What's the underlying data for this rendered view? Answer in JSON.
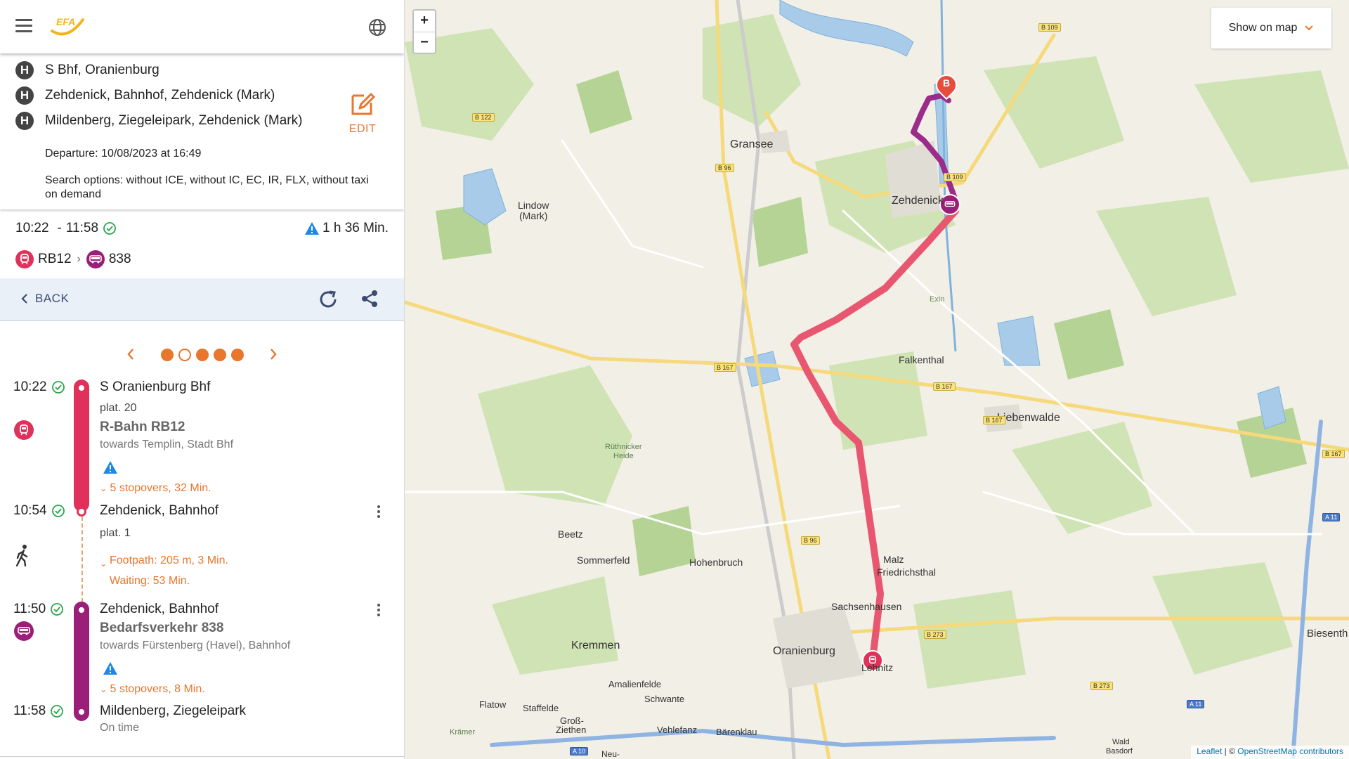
{
  "app": {
    "logo_text": "EFA"
  },
  "stops": [
    {
      "badge": "H",
      "name": "S Bhf, Oranienburg"
    },
    {
      "badge": "H",
      "name": "Zehdenick, Bahnhof, Zehdenick (Mark)"
    },
    {
      "badge": "H",
      "name": "Mildenberg, Ziegeleipark, Zehdenick (Mark)"
    }
  ],
  "edit_label": "EDIT",
  "departure": "Departure: 10/08/2023 at 16:49",
  "search_options": "Search options: without ICE, without IC, EC, IR, FLX, without taxi on demand",
  "summary": {
    "start": "10:22",
    "separator": "-",
    "end": "11:58",
    "duration": "1 h 36 Min.",
    "line1": "RB12",
    "line2": "838"
  },
  "back_label": "BACK",
  "legs": {
    "leg1": {
      "time": "10:22",
      "station": "S Oranienburg Bhf",
      "platform": "plat. 20",
      "line": "R-Bahn RB12",
      "towards": "towards Templin, Stadt Bhf",
      "stopovers": "5 stopovers, 32 Min."
    },
    "transfer": {
      "time": "10:54",
      "station": "Zehdenick, Bahnhof",
      "platform": "plat. 1",
      "footpath": "Footpath: 205 m, 3 Min.",
      "waiting": "Waiting: 53 Min."
    },
    "leg2": {
      "time": "11:50",
      "station": "Zehdenick, Bahnhof",
      "line": "Bedarfsverkehr 838",
      "towards": "towards Fürstenberg (Havel), Bahnhof",
      "stopovers": "5 stopovers, 8 Min."
    },
    "arrival": {
      "time": "11:58",
      "station": "Mildenberg, Ziegeleipark",
      "status": "On time"
    }
  },
  "map": {
    "zoom_in": "+",
    "zoom_out": "−",
    "show_on_map": "Show on map",
    "attribution_leaflet": "Leaflet",
    "attribution_sep": " | © ",
    "attribution_osm": "OpenStreetMap contributors",
    "destination_marker": "B",
    "places": {
      "gransee": "Gransee",
      "zehdenick": "Zehdenick",
      "lindow1": "Lindow",
      "lindow2": "(Mark)",
      "exin": "Exin",
      "falkenthal": "Falkenthal",
      "liebenwalde": "Liebenwalde",
      "ruethnicker1": "Rüthnicker",
      "ruethnicker2": "Heide",
      "beetz": "Beetz",
      "sommerfeld": "Sommerfeld",
      "hohenbruch": "Hohenbruch",
      "malz": "Malz",
      "friedrichsthal": "Friedrichsthal",
      "sachsenhausen": "Sachsenhausen",
      "kremmen": "Kremmen",
      "oranienburg": "Oranienburg",
      "lehnitz": "Lehnitz",
      "amalienfelde": "Amalienfelde",
      "schwante": "Schwante",
      "flatow": "Flatow",
      "staffelde": "Staffelde",
      "gross1": "Groß-",
      "gross2": "Ziethen",
      "vehlefanz": "Vehlefanz",
      "baerenklau": "Bärenklau",
      "kraemer": "Krämer",
      "neu": "Neu-",
      "biesenthal": "Biesenth",
      "wald1": "Wald",
      "wald2": "Basdorf"
    },
    "roads": {
      "b109a": "B 109",
      "b122": "B 122",
      "b96a": "B 96",
      "b109b": "B 109",
      "b167a": "B 167",
      "b167b": "B 167",
      "b167c": "B 167",
      "b167d": "B 167",
      "b96b": "B 96",
      "b273a": "B 273",
      "b273b": "B 273",
      "a11a": "A 11",
      "a11b": "A 11",
      "a10": "A 10"
    }
  },
  "colors": {
    "accent": "#e8762b",
    "train": "#e0315a",
    "bus": "#9b1f78",
    "ok": "#2aa64b",
    "warn": "#1e88e5"
  }
}
